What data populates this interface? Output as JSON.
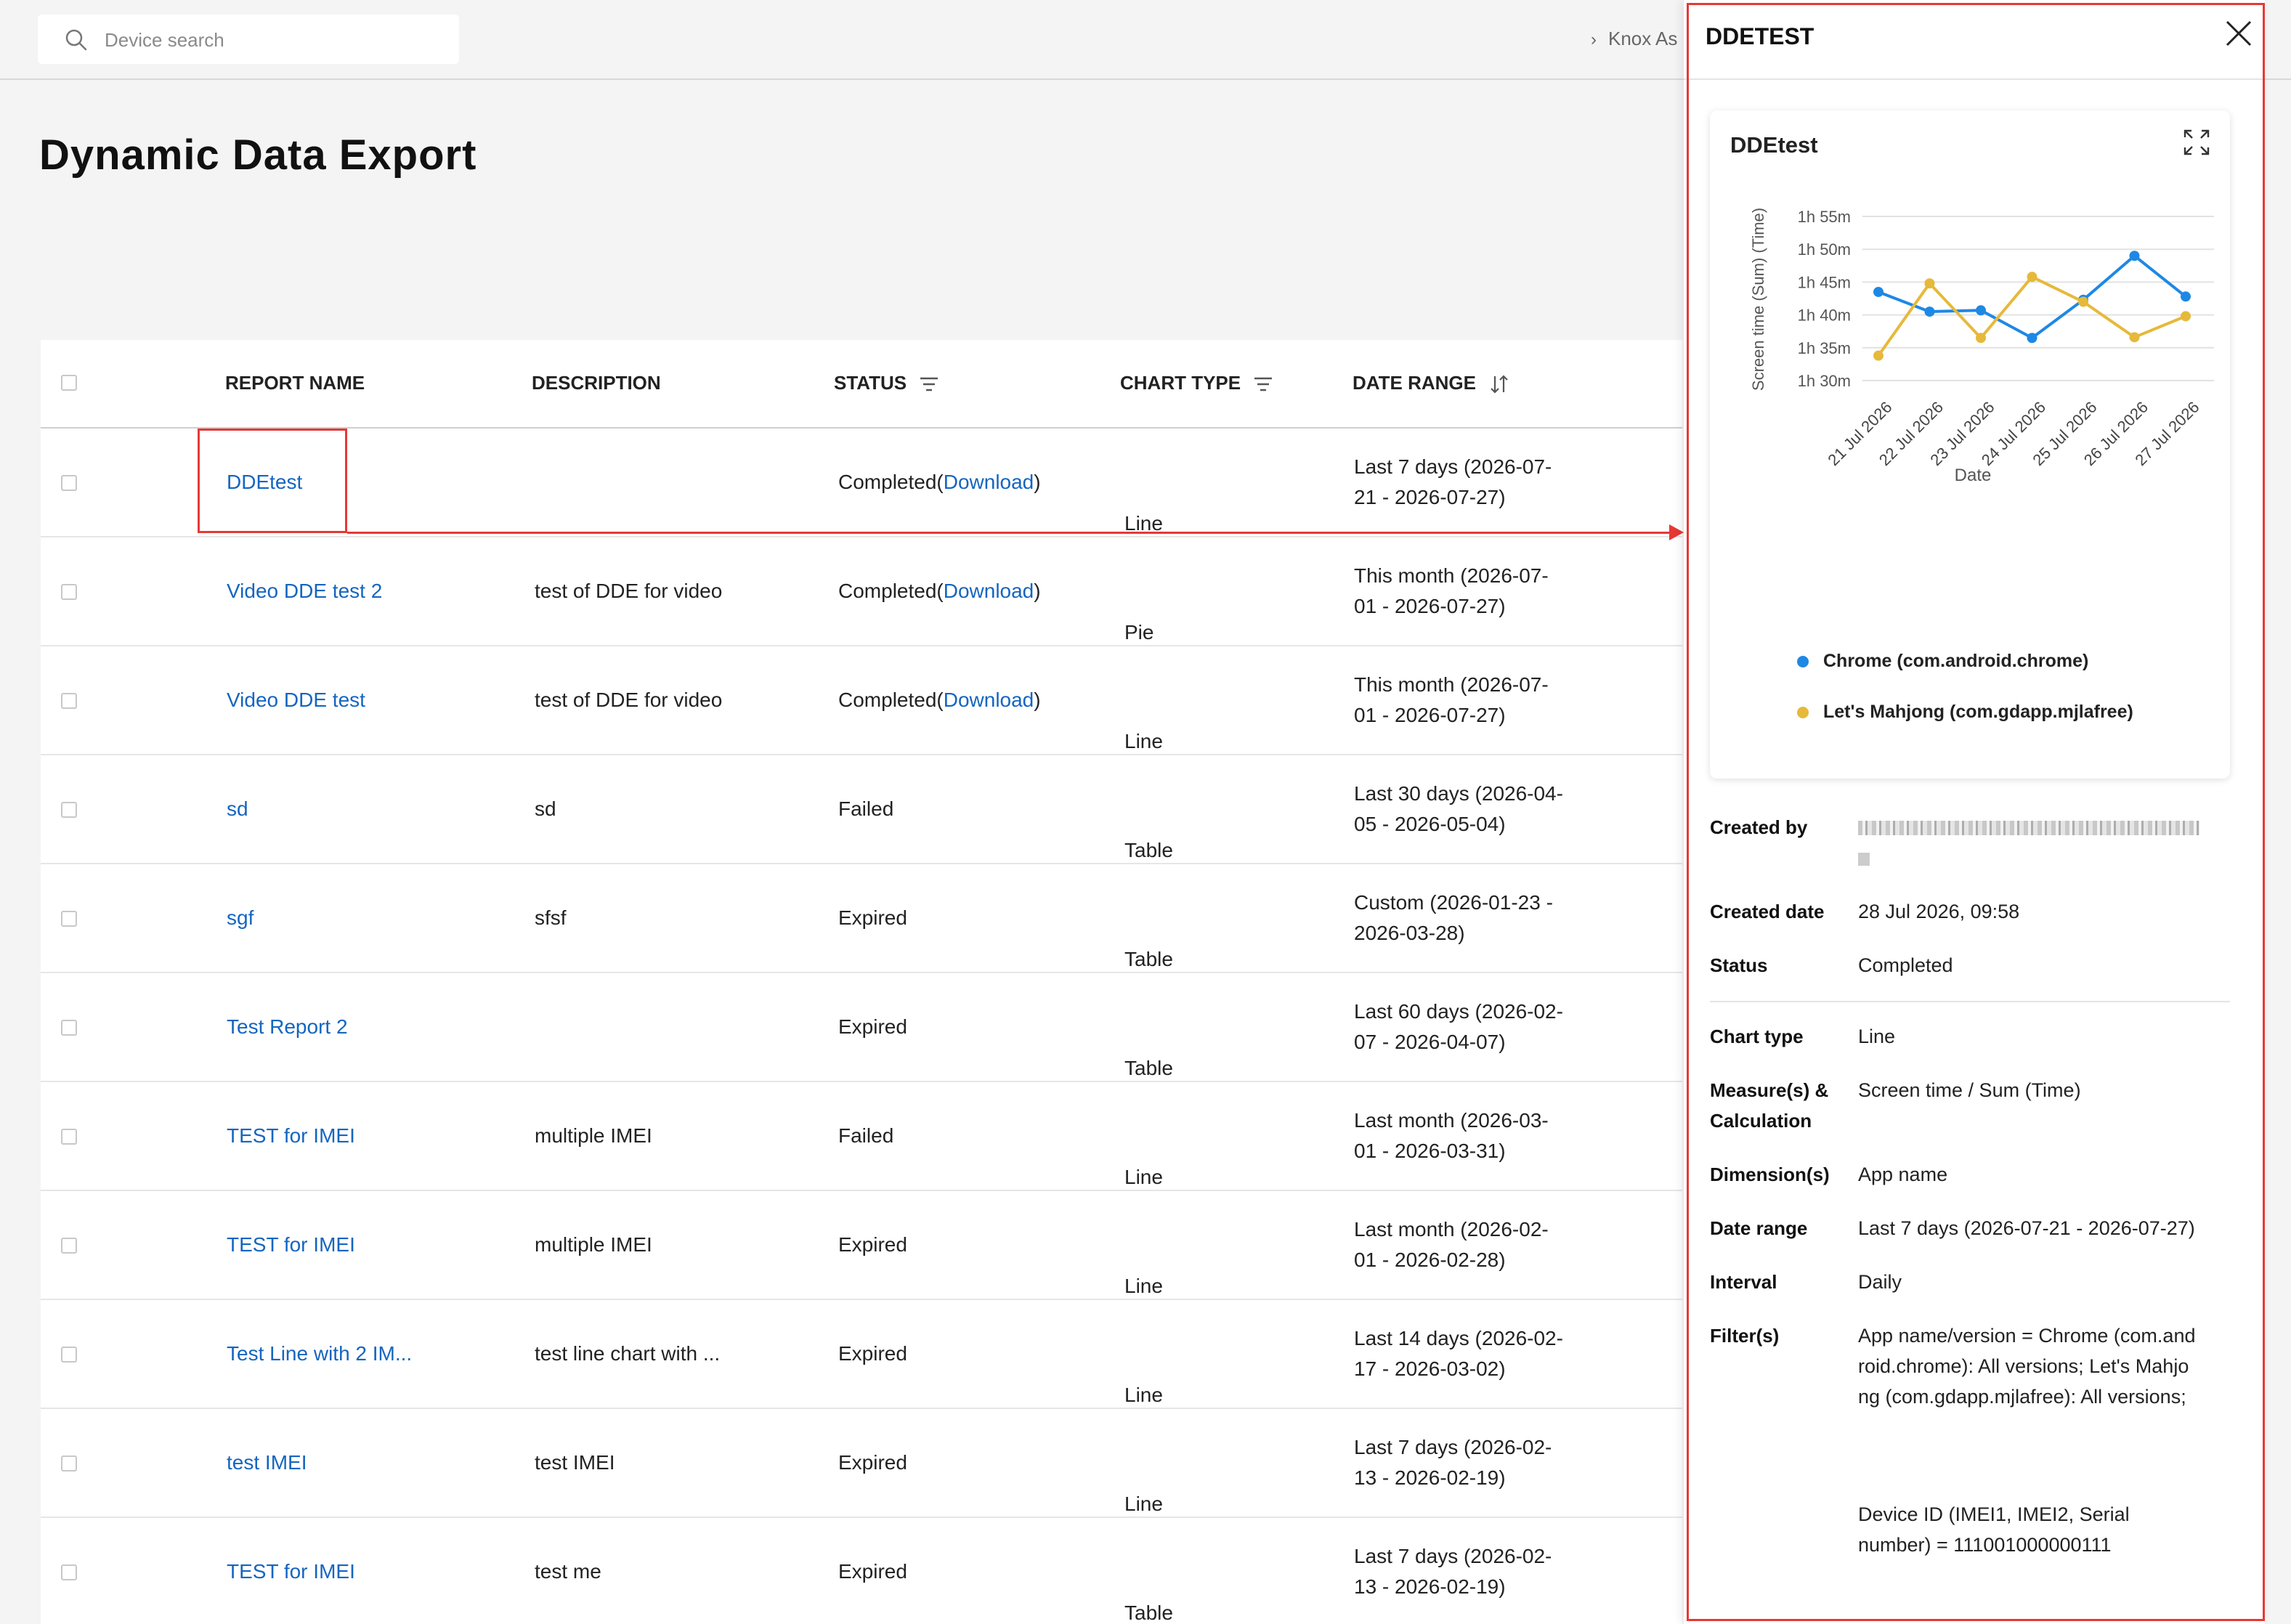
{
  "header": {
    "search_placeholder": "Device search",
    "breadcrumb": "Knox As"
  },
  "page_title": "Dynamic Data Export",
  "table": {
    "columns": {
      "report_name": "REPORT NAME",
      "description": "DESCRIPTION",
      "status": "STATUS",
      "chart_type": "CHART TYPE",
      "date_range": "DATE RANGE"
    },
    "rows": [
      {
        "name": "DDEtest",
        "description": "",
        "status": "Completed",
        "download": "Download",
        "chart_type": "Line",
        "date_range": "Last 7 days (2026-07-21 - 2026-07-27)"
      },
      {
        "name": "Video DDE test 2",
        "description": "test of DDE for video",
        "status": "Completed",
        "download": "Download",
        "chart_type": "Pie",
        "date_range": "This month (2026-07-01 - 2026-07-27)"
      },
      {
        "name": "Video DDE test",
        "description": "test of DDE for video",
        "status": "Completed",
        "download": "Download",
        "chart_type": "Line",
        "date_range": "This month (2026-07-01 - 2026-07-27)"
      },
      {
        "name": "sd",
        "description": "sd",
        "status": "Failed",
        "download": "",
        "chart_type": "Table",
        "date_range": "Last 30 days (2026-04-05 - 2026-05-04)"
      },
      {
        "name": "sgf",
        "description": "sfsf",
        "status": "Expired",
        "download": "",
        "chart_type": "Table",
        "date_range": "Custom (2026-01-23 - 2026-03-28)"
      },
      {
        "name": "Test Report 2",
        "description": "",
        "status": "Expired",
        "download": "",
        "chart_type": "Table",
        "date_range": "Last 60 days (2026-02-07 - 2026-04-07)"
      },
      {
        "name": "TEST for IMEI",
        "description": "multiple IMEI",
        "status": "Failed",
        "download": "",
        "chart_type": "Line",
        "date_range": "Last month (2026-03-01 - 2026-03-31)"
      },
      {
        "name": "TEST for IMEI",
        "description": "multiple IMEI",
        "status": "Expired",
        "download": "",
        "chart_type": "Line",
        "date_range": "Last month (2026-02-01 - 2026-02-28)"
      },
      {
        "name": "Test Line with 2 IM...",
        "description": "test line chart with ...",
        "status": "Expired",
        "download": "",
        "chart_type": "Line",
        "date_range": "Last 14 days (2026-02-17 - 2026-03-02)"
      },
      {
        "name": "test IMEI",
        "description": "test IMEI",
        "status": "Expired",
        "download": "",
        "chart_type": "Line",
        "date_range": "Last 7 days (2026-02-13 - 2026-02-19)"
      },
      {
        "name": "TEST for IMEI",
        "description": "test me",
        "status": "Expired",
        "download": "",
        "chart_type": "Table",
        "date_range": "Last 7 days (2026-02-13 - 2026-02-19)"
      }
    ]
  },
  "panel": {
    "title": "DDETEST",
    "card_title": "DDEtest",
    "details": {
      "created_by_label": "Created by",
      "created_date_label": "Created date",
      "created_date": "28 Jul 2026, 09:58",
      "status_label": "Status",
      "status": "Completed",
      "chart_type_label": "Chart type",
      "chart_type": "Line",
      "measures_label": "Measure(s) & Calculation",
      "measures": "Screen time / Sum (Time)",
      "dimensions_label": "Dimension(s)",
      "dimensions": "App name",
      "date_range_label": "Date range",
      "date_range": "Last 7 days (2026-07-21 - 2026-07-27)",
      "interval_label": "Interval",
      "interval": "Daily",
      "filters_label": "Filter(s)",
      "filter_1": "App name/version = Chrome (com.android.chrome): All versions; Let's Mahjong (com.gdapp.mjlafree): All versions;",
      "filter_2": "Device ID (IMEI1, IMEI2, Serial number) = 111001000000111"
    }
  },
  "colors": {
    "accent": "#1565c0",
    "highlight": "#e53935",
    "series_blue": "#1e88e5",
    "series_yellow": "#e6b93a"
  },
  "chart_data": {
    "type": "line",
    "title": "DDEtest",
    "xlabel": "Date",
    "ylabel": "Screen time (Sum) (Time)",
    "categories": [
      "21 Jul 2026",
      "22 Jul 2026",
      "23 Jul 2026",
      "24 Jul 2026",
      "25 Jul 2026",
      "26 Jul 2026",
      "27 Jul 2026"
    ],
    "y_ticks": [
      "1h 30m",
      "1h 35m",
      "1h 40m",
      "1h 45m",
      "1h 50m",
      "1h 55m"
    ],
    "y_unit": "minutes",
    "ylim": [
      90,
      115
    ],
    "series": [
      {
        "name": "Chrome (com.android.chrome)",
        "color": "#1e88e5",
        "values": [
          103.5,
          100.5,
          100.7,
          96.5,
          102.3,
          109,
          102.8
        ],
        "extra_points": []
      },
      {
        "name": "Let's Mahjong (com.gdapp.mjlafree)",
        "color": "#e6b93a",
        "values": [
          93.8,
          104.8,
          96.5,
          105.8,
          102,
          96.6,
          99.8
        ]
      }
    ],
    "legend_position": "bottom"
  }
}
